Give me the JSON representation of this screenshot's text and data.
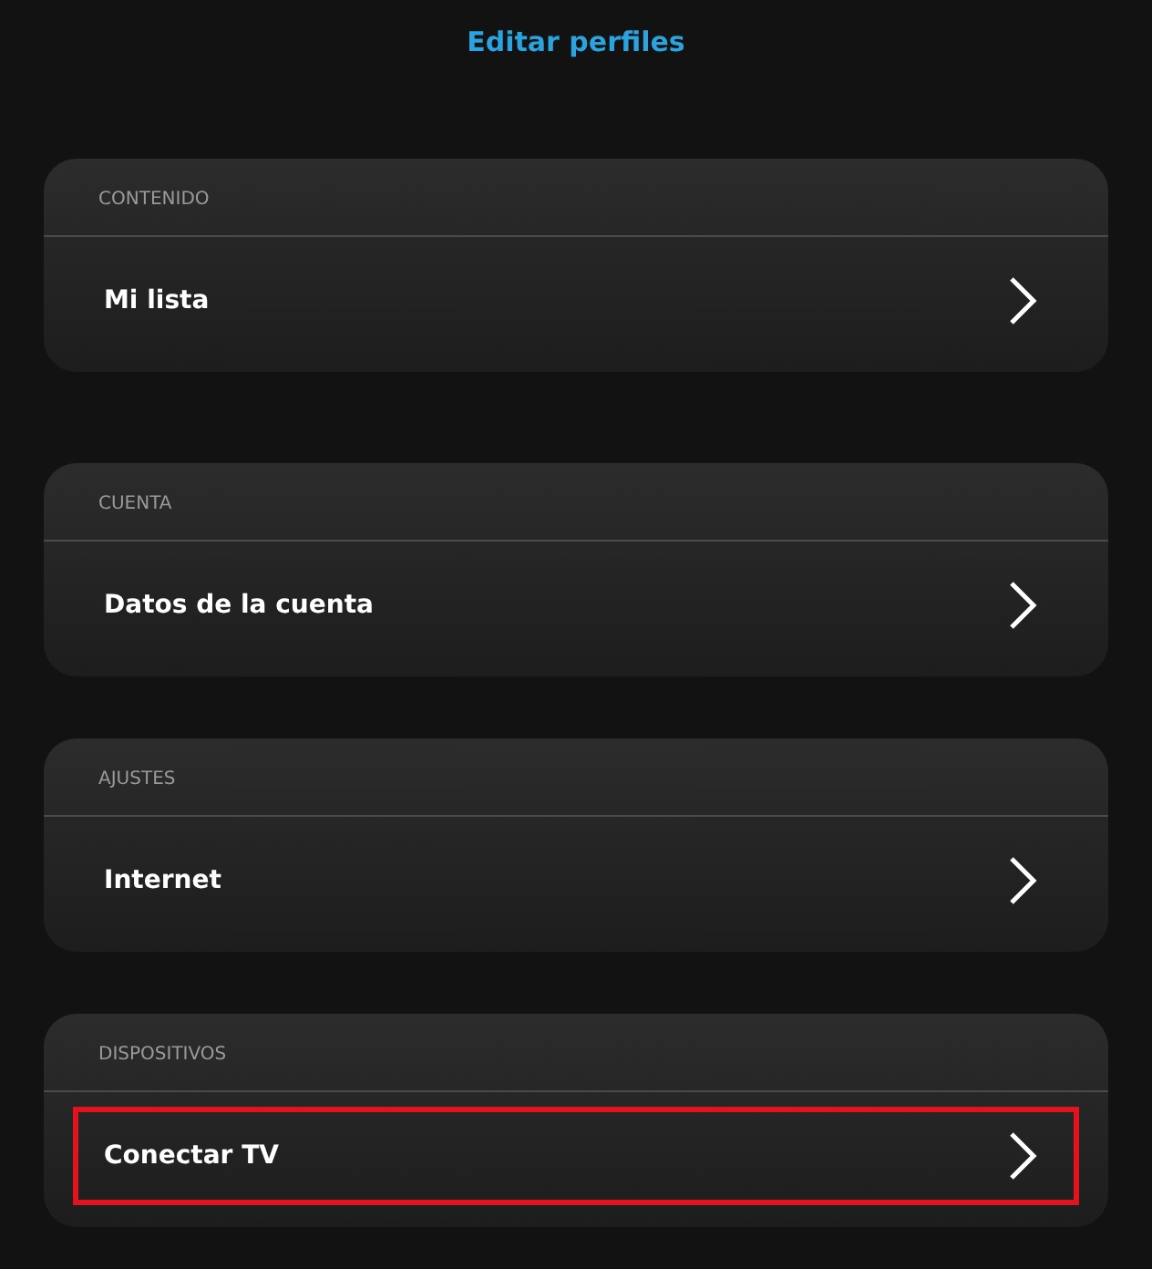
{
  "title": "Editar perfiles",
  "sections": [
    {
      "header": "CONTENIDO",
      "items": [
        {
          "label": "Mi lista",
          "highlighted": false
        }
      ]
    },
    {
      "header": "CUENTA",
      "items": [
        {
          "label": "Datos de la cuenta",
          "highlighted": false
        }
      ]
    },
    {
      "header": "AJUSTES",
      "items": [
        {
          "label": "Internet",
          "highlighted": false
        }
      ]
    },
    {
      "header": "DISPOSITIVOS",
      "items": [
        {
          "label": "Conectar TV",
          "highlighted": true
        }
      ]
    }
  ]
}
